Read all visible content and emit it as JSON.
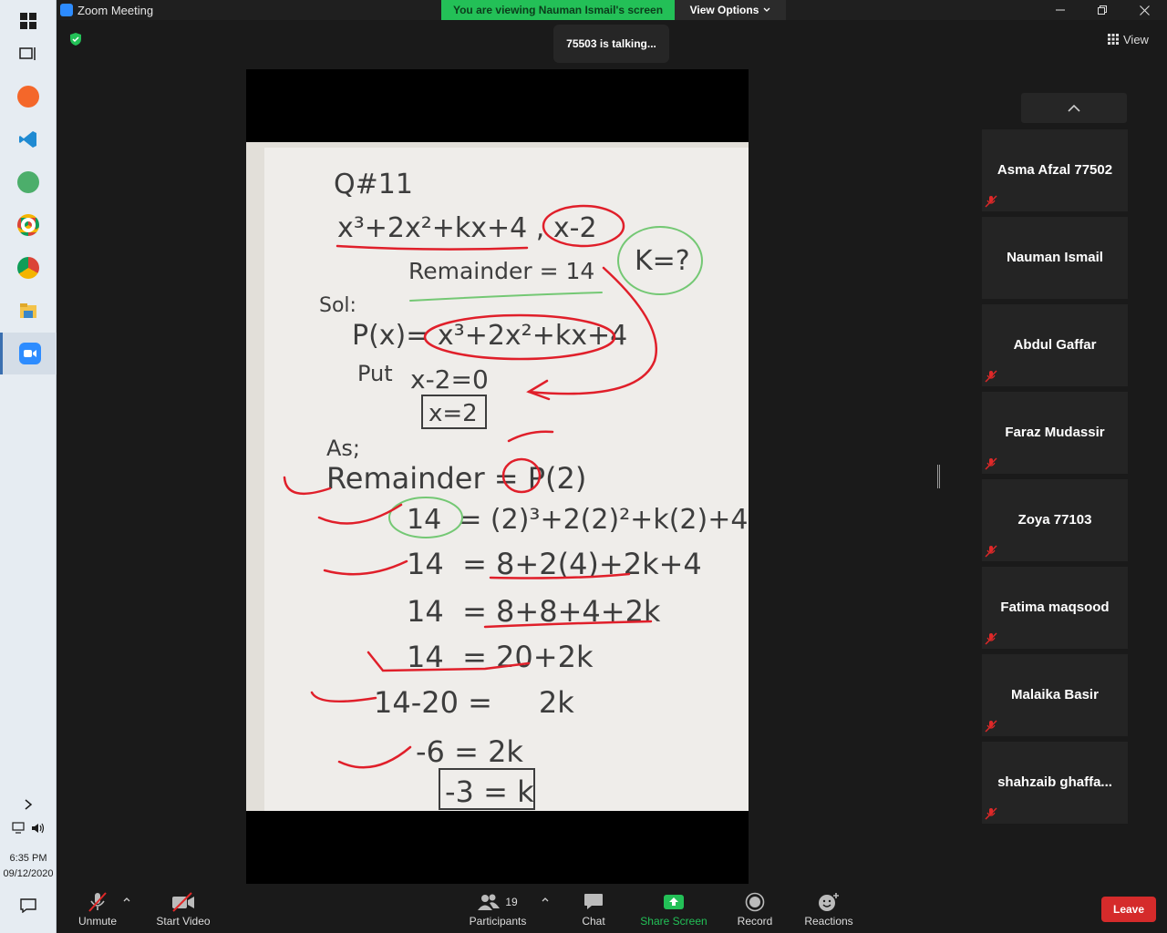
{
  "window": {
    "title": "Zoom Meeting"
  },
  "banner": {
    "viewing": "You are viewing Nauman Ismail's screen",
    "view_options": "View Options"
  },
  "talking": "75503 is talking...",
  "view_button": "View",
  "whiteboard": {
    "lines": [
      "Q#11",
      "x³+2x²+kx+4 , x-2",
      "Remainder = 14",
      "K=?",
      "Sol:",
      "P(x)= x³+2x²+kx+4",
      "Put",
      "x-2=0",
      "x=2",
      "As;",
      "Remainder = P(2)",
      "14  = (2)³+2(2)²+k(2)+4",
      "14  = 8+2(4)+2k+4",
      "14  = 8+8+4+2k",
      "14  = 20+2k",
      "14-20 =     2k",
      "-6 = 2k",
      "-3 = k"
    ]
  },
  "participants": [
    {
      "name": "Asma Afzal 77502",
      "muted": true
    },
    {
      "name": "Nauman Ismail",
      "muted": false
    },
    {
      "name": "Abdul Gaffar",
      "muted": true
    },
    {
      "name": "Faraz Mudassir",
      "muted": true
    },
    {
      "name": "Zoya 77103",
      "muted": true
    },
    {
      "name": "Fatima maqsood",
      "muted": true
    },
    {
      "name": "Malaika Basir",
      "muted": true
    },
    {
      "name": "shahzaib  ghaffa...",
      "muted": true
    }
  ],
  "toolbar": {
    "unmute": "Unmute",
    "start_video": "Start Video",
    "participants": "Participants",
    "participants_count": "19",
    "chat": "Chat",
    "share_screen": "Share Screen",
    "record": "Record",
    "reactions": "Reactions",
    "leave": "Leave"
  },
  "system_tray": {
    "time": "6:35 PM",
    "date": "09/12/2020"
  },
  "colors": {
    "accent_green": "#23c057",
    "leave_red": "#d52b2b",
    "zoom_blue": "#2d8cff",
    "ink_red": "#e01f2a"
  }
}
